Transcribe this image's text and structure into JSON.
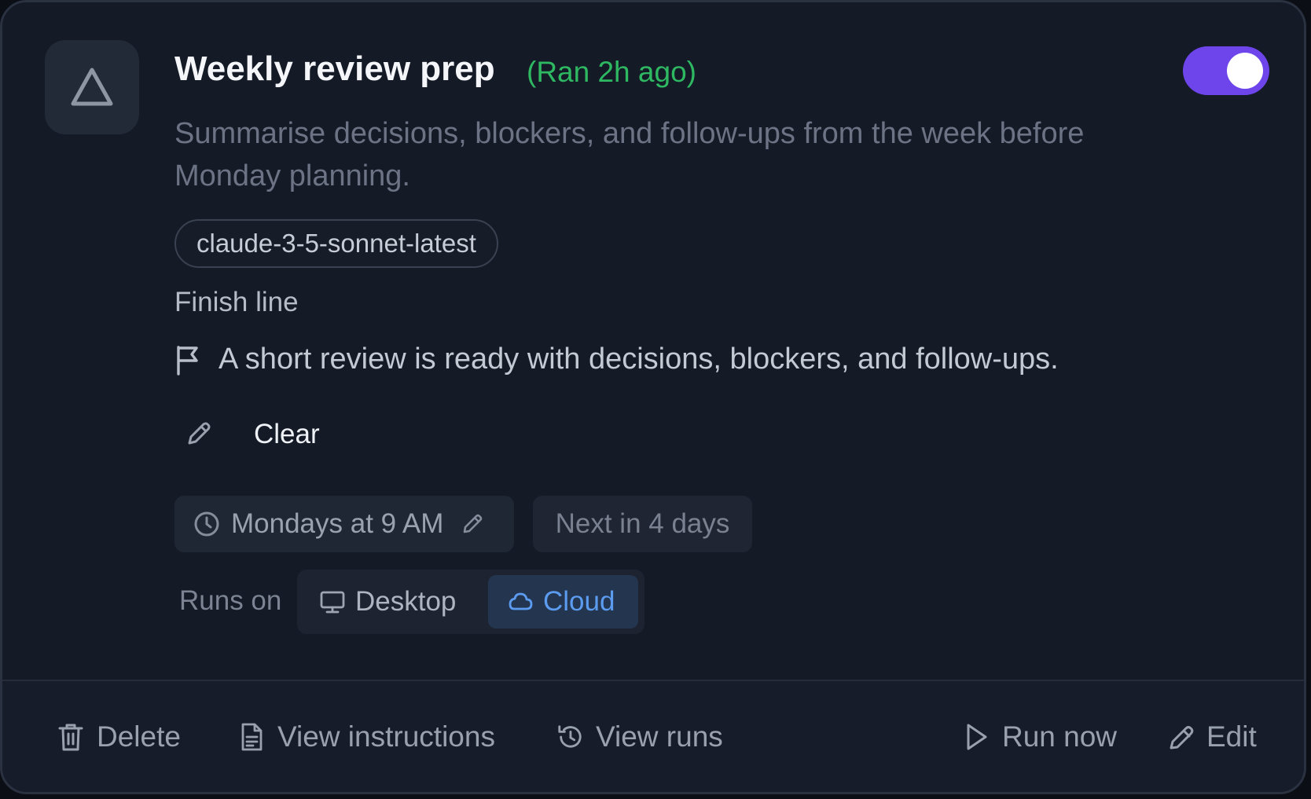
{
  "task": {
    "title": "Weekly review prep",
    "last_run": "(Ran 2h ago)",
    "enabled": true,
    "description": "Summarise decisions, blockers, and follow-ups from the week before Monday planning.",
    "model": "claude-3-5-sonnet-latest"
  },
  "finish": {
    "label": "Finish line",
    "text": "A short review is ready with decisions, blockers, and follow-ups."
  },
  "clear": {
    "label": "Clear"
  },
  "schedule": {
    "text": "Mondays at 9 AM",
    "next": "Next in 4 days"
  },
  "runs_on": {
    "label": "Runs on",
    "options": [
      {
        "label": "Desktop",
        "icon": "monitor-icon",
        "selected": false
      },
      {
        "label": "Cloud",
        "icon": "cloud-icon",
        "selected": true
      }
    ]
  },
  "footer": {
    "delete": "Delete",
    "view_instructions": "View instructions",
    "view_runs": "View runs",
    "run_now": "Run now",
    "edit": "Edit"
  },
  "colors": {
    "accent": "#6d45ea",
    "success": "#2fb862",
    "selected": "#5b9cf0"
  }
}
